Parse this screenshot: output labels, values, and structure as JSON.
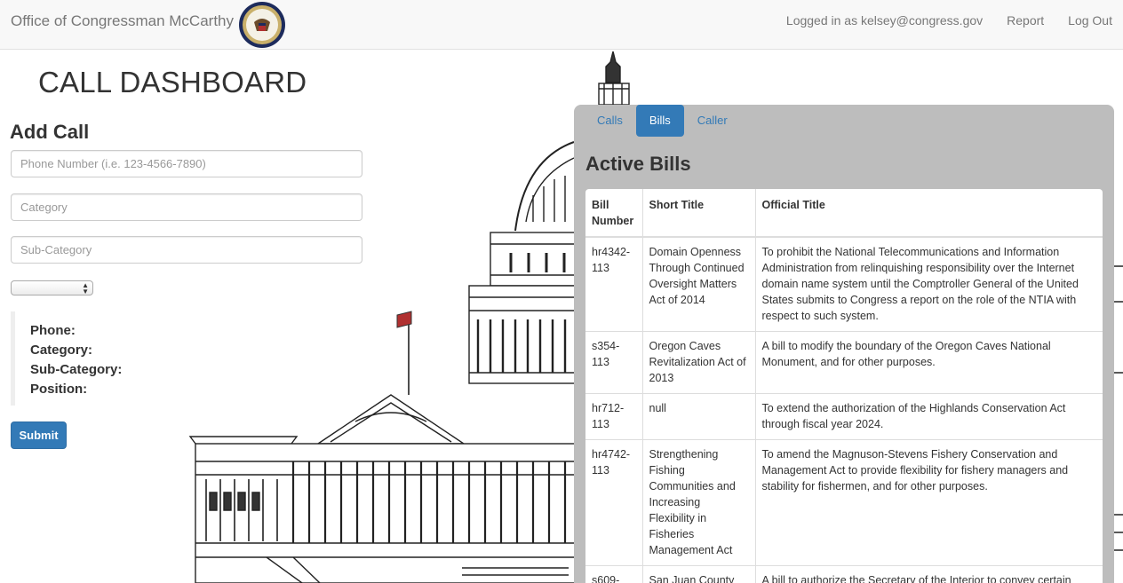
{
  "navbar": {
    "brand": "Office of Congressman McCarthy",
    "seal_icon": "congress-seal-icon",
    "logged_in": "Logged in as kelsey@congress.gov",
    "report": "Report",
    "logout": "Log Out"
  },
  "dashboard": {
    "title": "CALL DASHBOARD"
  },
  "add_call": {
    "heading": "Add Call",
    "phone_placeholder": "Phone Number (i.e. 123-4566-7890)",
    "category_placeholder": "Category",
    "subcategory_placeholder": "Sub-Category",
    "position_select_value": "",
    "summary": {
      "phone": "Phone:",
      "category": "Category:",
      "subcategory": "Sub-Category:",
      "position": "Position:"
    },
    "submit": "Submit"
  },
  "panel": {
    "tabs": [
      {
        "label": "Calls",
        "active": false
      },
      {
        "label": "Bills",
        "active": true
      },
      {
        "label": "Caller",
        "active": false
      }
    ],
    "title": "Active Bills",
    "columns": [
      "Bill Number",
      "Short Title",
      "Official Title"
    ],
    "rows": [
      {
        "number": "hr4342-113",
        "short": "Domain Openness Through Continued Oversight Matters Act of 2014",
        "official": "To prohibit the National Telecommunications and Information Administration from relinquishing responsibility over the Internet domain name system until the Comptroller General of the United States submits to Congress a report on the role of the NTIA with respect to such system."
      },
      {
        "number": "s354-113",
        "short": "Oregon Caves Revitalization Act of 2013",
        "official": "A bill to modify the boundary of the Oregon Caves National Monument, and for other purposes."
      },
      {
        "number": "hr712-113",
        "short": "null",
        "official": "To extend the authorization of the Highlands Conservation Act through fiscal year 2024."
      },
      {
        "number": "hr4742-113",
        "short": "Strengthening Fishing Communities and Increasing Flexibility in Fisheries Management Act",
        "official": "To amend the Magnuson-Stevens Fishery Conservation and Management Act to provide flexibility for fishery managers and stability for fishermen, and for other purposes."
      },
      {
        "number": "s609-",
        "short": "San Juan County",
        "official": "A bill to authorize the Secretary of the Interior to convey certain"
      }
    ]
  },
  "colors": {
    "primary": "#337ab7",
    "panel_bg": "#bdbdbd",
    "navbar_bg": "#f8f8f8"
  }
}
